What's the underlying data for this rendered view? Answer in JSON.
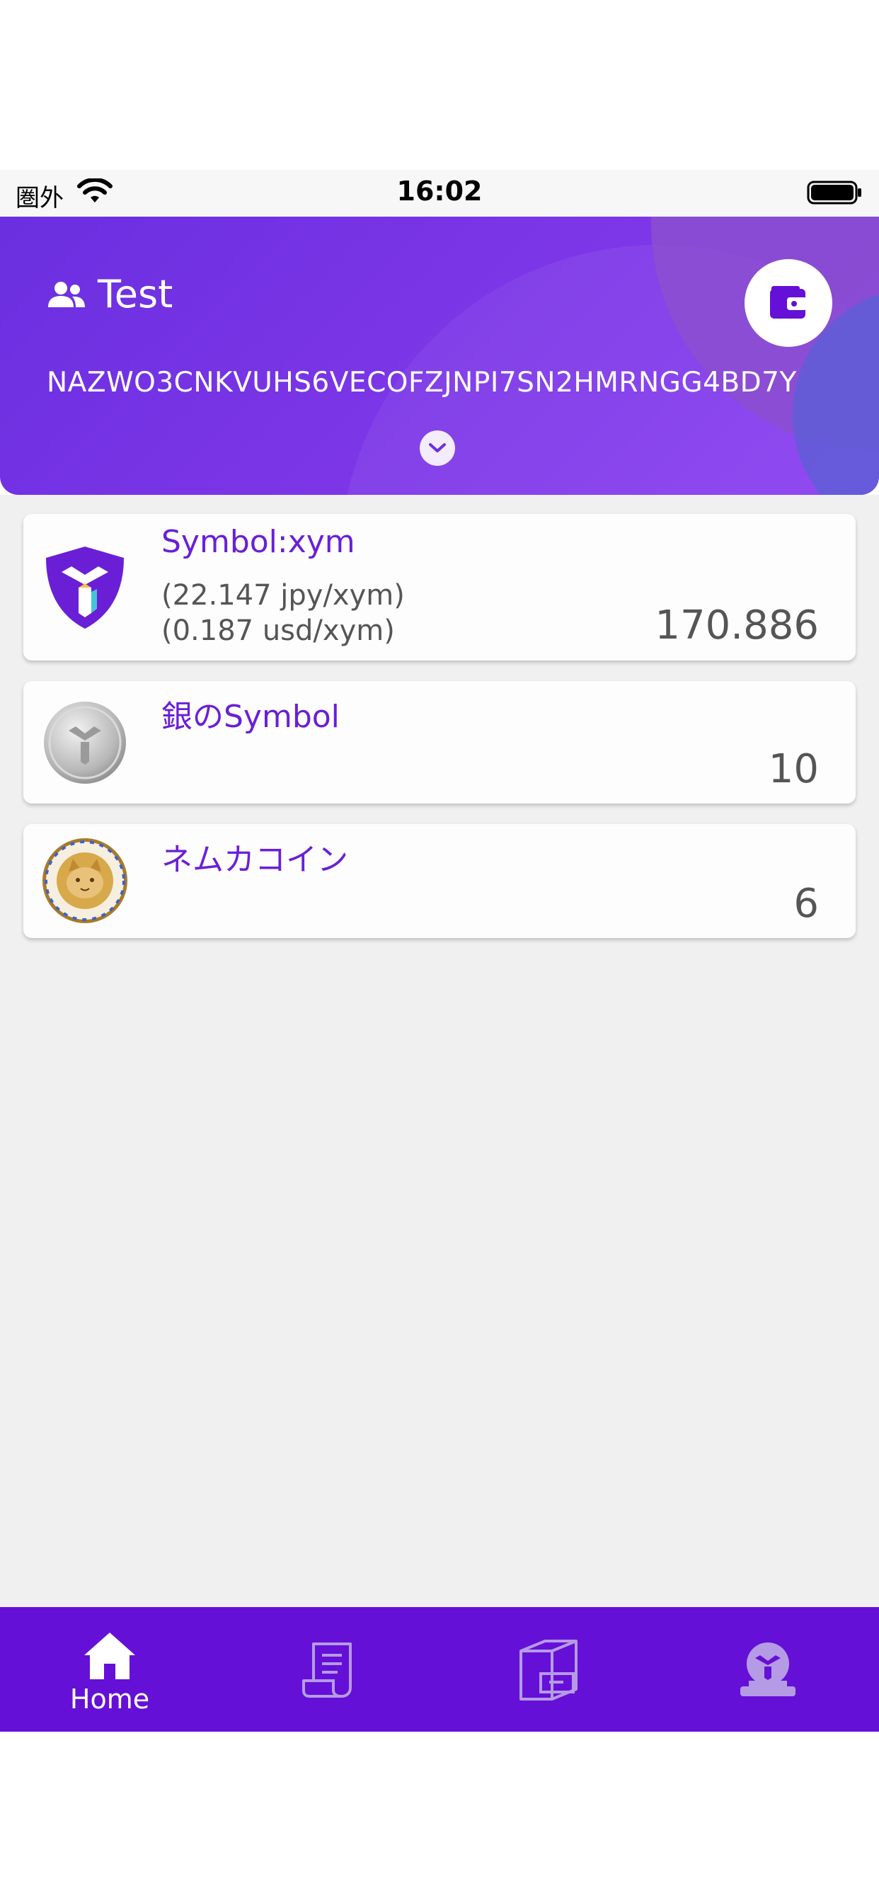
{
  "status_bar": {
    "carrier": "圏外",
    "time": "16:02"
  },
  "account": {
    "name": "Test",
    "address": "NAZWO3CNKVUHS6VECOFZJNPI7SN2HMRNGG4BD7Y"
  },
  "assets": [
    {
      "name": "Symbol:xym",
      "rate_jpy": "(22.147 jpy/xym)",
      "rate_usd": "(0.187 usd/xym)",
      "amount": "170.886",
      "icon": "symbol-logo-icon"
    },
    {
      "name": "銀のSymbol",
      "amount": "10",
      "icon": "silver-coin-icon"
    },
    {
      "name": "ネムカコイン",
      "amount": "6",
      "icon": "cat-coin-icon"
    }
  ],
  "tab_bar": {
    "tabs": [
      {
        "label": "Home",
        "icon": "home-icon",
        "active": true
      },
      {
        "label": "",
        "icon": "receipt-icon",
        "active": false
      },
      {
        "label": "",
        "icon": "archive-icon",
        "active": false
      },
      {
        "label": "",
        "icon": "symbol-node-icon",
        "active": false
      }
    ]
  },
  "colors": {
    "brand": "#6510d6",
    "header_gradient_start": "#6a2fe0",
    "header_gradient_end": "#8a3ff0",
    "asset_name": "#6a1fd6",
    "text_gray": "#555555",
    "content_bg": "#f0f0f0"
  }
}
